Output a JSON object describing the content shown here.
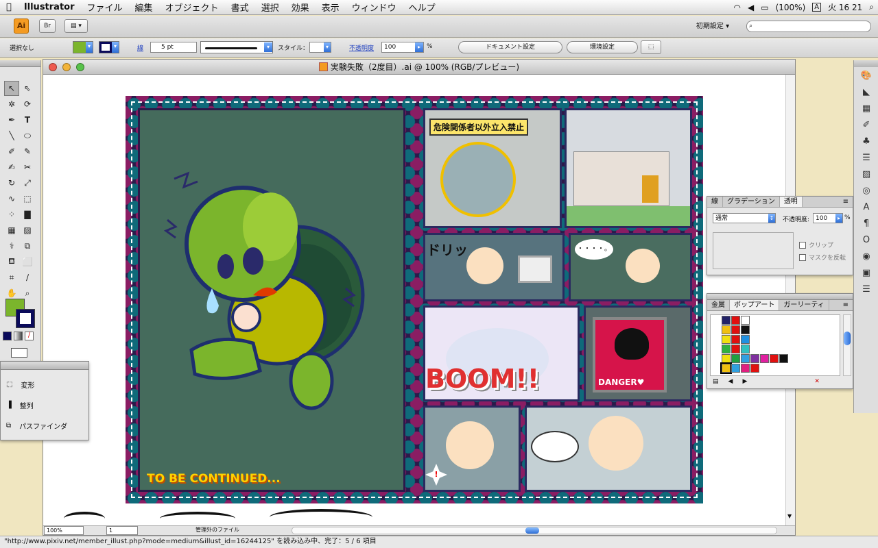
{
  "menubar": {
    "app": "Illustrator",
    "items": [
      "ファイル",
      "編集",
      "オブジェクト",
      "書式",
      "選択",
      "効果",
      "表示",
      "ウィンドウ",
      "ヘルプ"
    ],
    "battery": "(100%)",
    "input_method": "A",
    "clock": "火 16 21"
  },
  "control_bar": {
    "app_badge": "Ai",
    "bridge": "Br",
    "workspace": "初期設定 ▾",
    "selection_status": "選択なし",
    "stroke_label": "線",
    "stroke_value": "5 pt",
    "style_label": "スタイル：",
    "opacity_label": "不透明度",
    "opacity_value": "100",
    "opacity_unit": "%",
    "doc_settings_button": "ドキュメント設定",
    "env_settings_button": "環境設定"
  },
  "document": {
    "title": "実験失敗（2度目）.ai @ 100% (RGB/プレビュー)",
    "zoom": "100%",
    "page": "1",
    "status_text": "管理外のファイル"
  },
  "artwork": {
    "continued_text": "TO BE CONTINUED...",
    "sign_text": "危険関係者以外立入禁止",
    "sfx_dori": "ドリッ",
    "boom_text": "BOOM!!",
    "danger_text": "DANGER♥",
    "speech_dots": "・・・・。"
  },
  "tool_panel": {
    "items": [
      "変形",
      "整列",
      "パスファインダ"
    ]
  },
  "transparency_panel": {
    "tabs": [
      "線",
      "グラデーション",
      "透明"
    ],
    "blend_mode": "通常",
    "opacity_label": "不透明度:",
    "opacity_value": "100",
    "opacity_unit": "%",
    "clip_label": "クリップ",
    "invert_mask_label": "マスクを反転"
  },
  "swatch_panel": {
    "tabs": [
      "金属",
      "ポップアート",
      "ガーリーティ"
    ]
  },
  "browser_status": "\"http://www.pixiv.net/member_illust.php?mode=medium&illust_id=16244125\" を読み込み中、完了：5 / 6 項目"
}
